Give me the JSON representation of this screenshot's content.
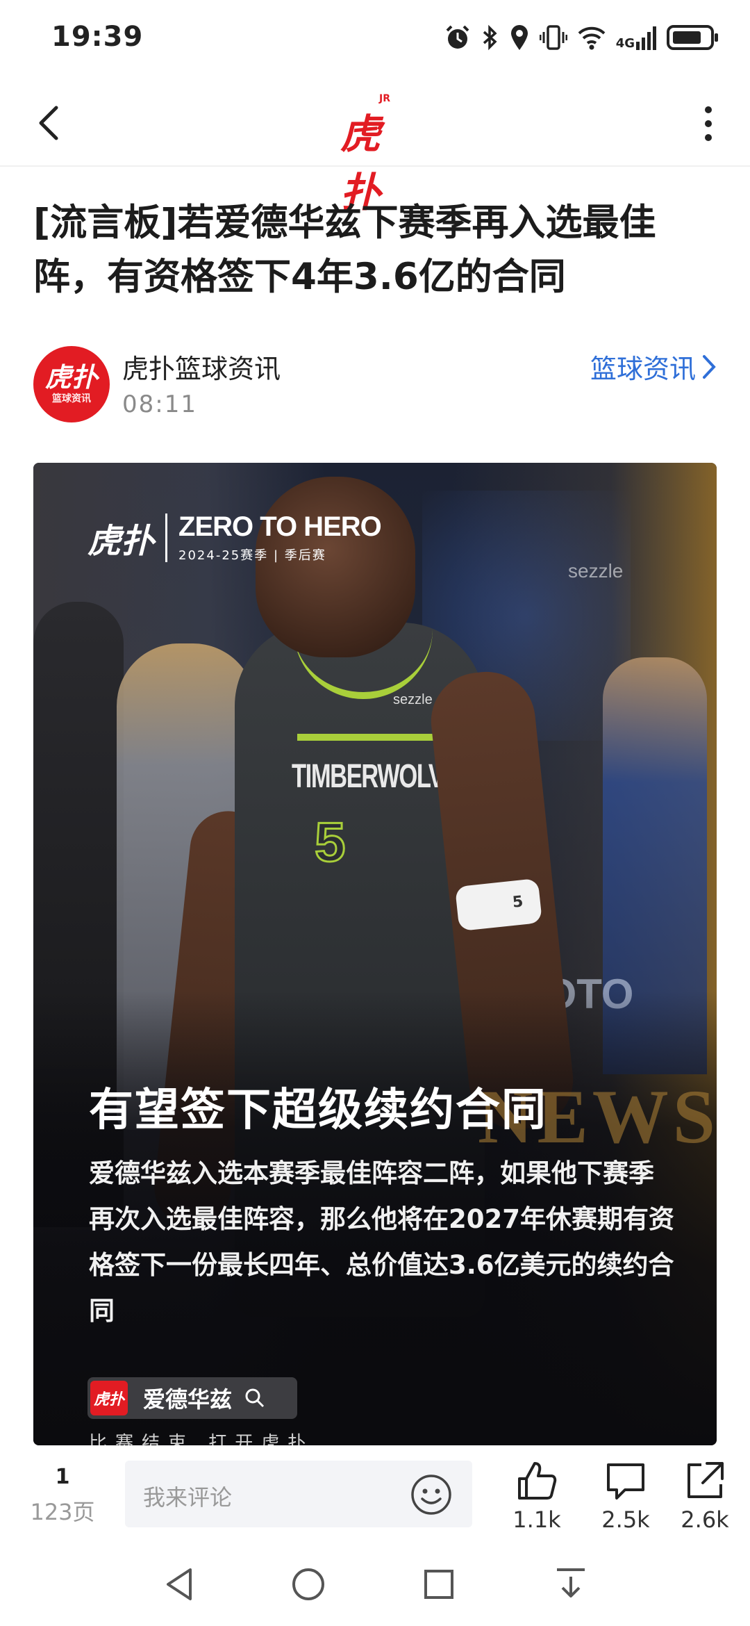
{
  "status_bar": {
    "time": "19:39",
    "network": "4G",
    "icons": [
      "alarm-icon",
      "bluetooth-icon",
      "location-icon",
      "vibrate-icon",
      "wifi-icon",
      "signal-icon",
      "battery-icon"
    ]
  },
  "nav": {
    "back_icon": "back-icon",
    "logo_text": "虎扑",
    "logo_badge": "JR",
    "more_icon": "more-icon",
    "brand_color": "#e21c23"
  },
  "article": {
    "title": "[流言板]若爱德华兹下赛季再入选最佳阵，有资格签下4年3.6亿的合同",
    "author": "虎扑篮球资讯",
    "time": "08:11",
    "category": "篮球资讯",
    "avatar_main": "虎扑",
    "avatar_sub": "篮球资讯",
    "link_color": "#2f6fd8"
  },
  "image": {
    "brand_logo": "虎扑",
    "brand_title": "ZERO TO HERO",
    "brand_sub": "2024-25赛季 | 季后赛",
    "jersey_text": "TIMBERWOLVES",
    "jersey_number": "5",
    "armband_number": "5",
    "sponsor": "sezzle",
    "arena_logo": "sezzle",
    "arena_board": "TOTO",
    "watermark": "NEWS",
    "headline": "有望签下超级续约合同",
    "body": "爱德华兹入选本赛季最佳阵容二阵，如果他下赛季再次入选最佳阵容，那么他将在2027年休赛期有资格签下一份最长四年、总价值达3.6亿美元的续约合同",
    "search_pill_logo": "虎扑",
    "search_pill_text": "爱德华兹",
    "caption": "比赛结束 打开虎扑"
  },
  "action_bar": {
    "page_current": "1",
    "page_total": "123页",
    "comment_placeholder": "我来评论",
    "likes": "1.1k",
    "comments": "2.5k",
    "shares": "2.6k"
  },
  "system_nav": {
    "buttons": [
      "back-triangle-icon",
      "home-circle-icon",
      "recents-square-icon",
      "notification-pulldown-icon"
    ]
  }
}
